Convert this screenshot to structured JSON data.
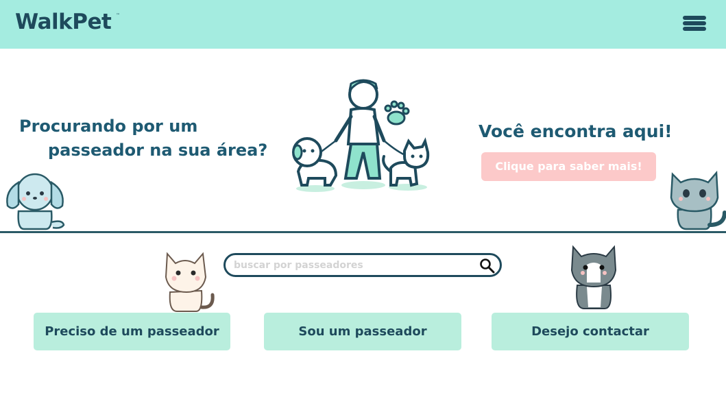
{
  "header": {
    "logo_text": "WalkPet",
    "logo_tm": "™",
    "menu_icon": "hamburger-menu-icon"
  },
  "hero": {
    "left_line1": "Procurando por um",
    "left_line2": "passeador na sua área?",
    "right_title": "Você encontra aqui!",
    "cta_label": "Clique para saber mais!"
  },
  "search": {
    "placeholder": "buscar por passeadores",
    "value": "",
    "icon": "search-icon"
  },
  "actions": {
    "need_walker_label": "Preciso de um passeador",
    "am_walker_label": "Sou um passeador",
    "contact_label": "Desejo contactar"
  },
  "colors": {
    "header_bg": "#a4ece0",
    "brand_dark": "#1e4a5c",
    "heading_teal": "#1e5a72",
    "cta_pink": "#fcc9c9",
    "button_mint": "#b9eedd"
  }
}
